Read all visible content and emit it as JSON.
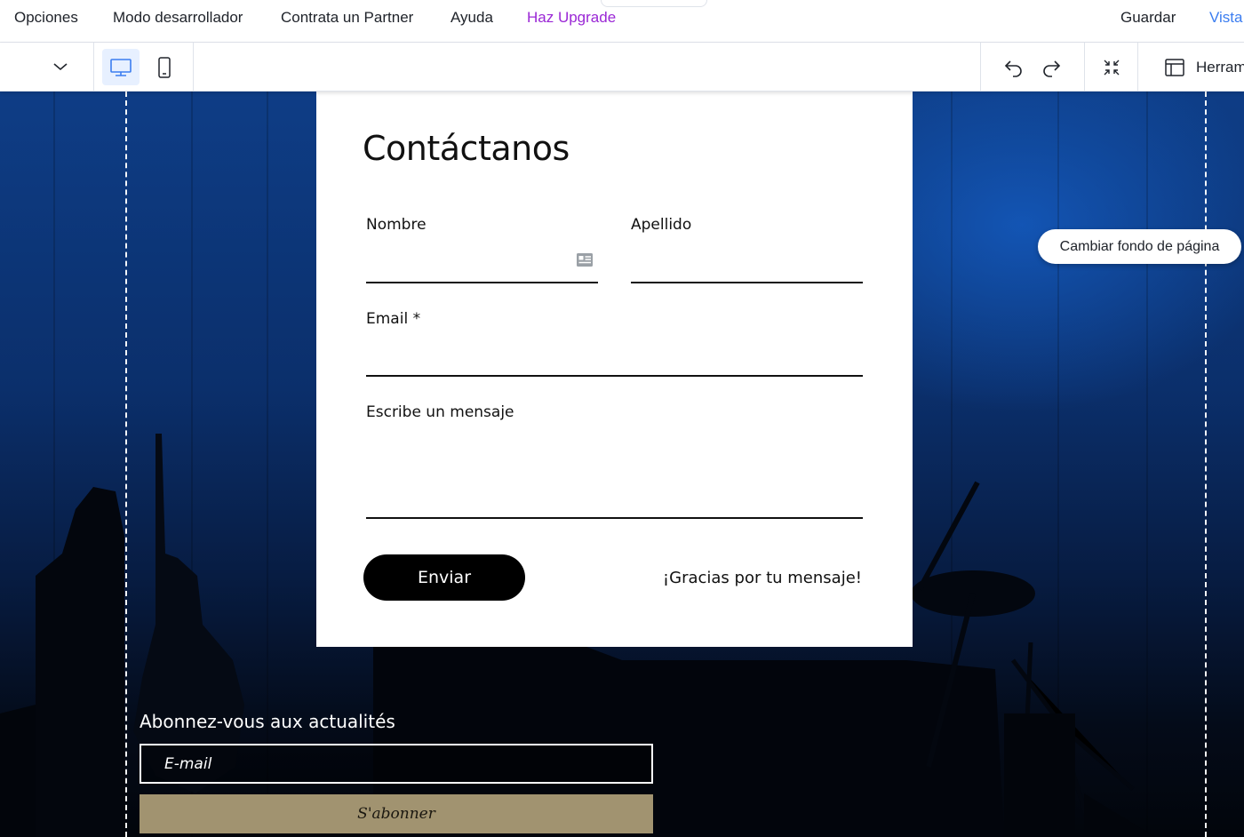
{
  "menubar": {
    "items": [
      "Opciones",
      "Modo desarrollador",
      "Contrata un Partner",
      "Ayuda"
    ],
    "upgrade": "Haz Upgrade",
    "save": "Guardar",
    "preview": "Vista"
  },
  "toolbar": {
    "tools_label": "Herram"
  },
  "tooltip": "Cambiar fondo de página",
  "contact_form": {
    "title": "Contáctanos",
    "first_name_label": "Nombre",
    "last_name_label": "Apellido",
    "email_label": "Email *",
    "message_label": "Escribe un mensaje",
    "submit_label": "Enviar",
    "success_message": "¡Gracias por tu mensaje!"
  },
  "newsletter": {
    "title": "Abonnez-vous aux actualités",
    "email_placeholder": "E-mail",
    "button_label": "S'abonner"
  },
  "colors": {
    "upgrade": "#9a27d5",
    "preview_link": "#3b7df0",
    "subscribe_button": "#a19370",
    "active_device": "#e7f0ff"
  }
}
